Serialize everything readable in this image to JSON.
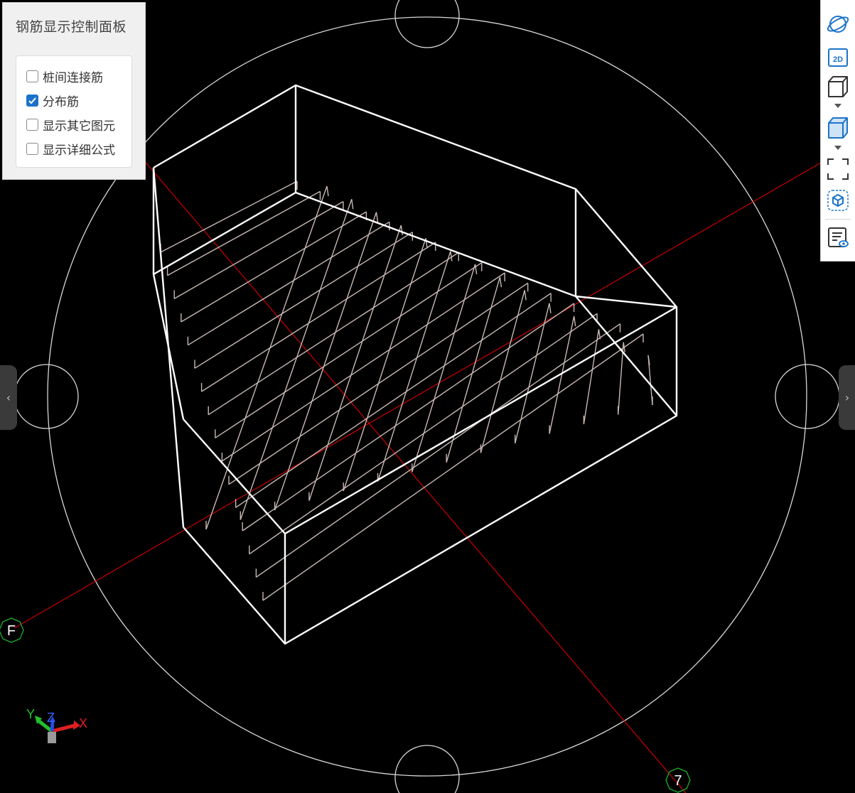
{
  "panel": {
    "title": "钢筋显示控制面板",
    "options": [
      {
        "label": "桩间连接筋",
        "checked": false
      },
      {
        "label": "分布筋",
        "checked": true
      },
      {
        "label": "显示其它图元",
        "checked": false
      },
      {
        "label": "显示详细公式",
        "checked": false
      }
    ]
  },
  "axes": {
    "labels": [
      "F",
      "7"
    ]
  },
  "coordinate_indicator": {
    "x": "X",
    "y": "Y",
    "z": "Z"
  },
  "toolbar": {
    "buttons": [
      "orbit-icon",
      "2d-view-icon",
      "wireframe-cube-icon",
      "solid-cube-icon",
      "fit-view-icon",
      "isolate-cube-icon",
      "display-settings-icon"
    ],
    "labels": {
      "two_d": "2D"
    }
  },
  "side_tabs": {
    "left": "‹",
    "right": "›"
  },
  "colors": {
    "background": "#000000",
    "axis_line": "#cc0000",
    "axis_marker": "#1fae2f",
    "wireframe": "#ffffff",
    "rebar": "#c8b9b4",
    "checkbox_checked": "#1b73c9",
    "toolbar_icon": "#1b73c9"
  }
}
